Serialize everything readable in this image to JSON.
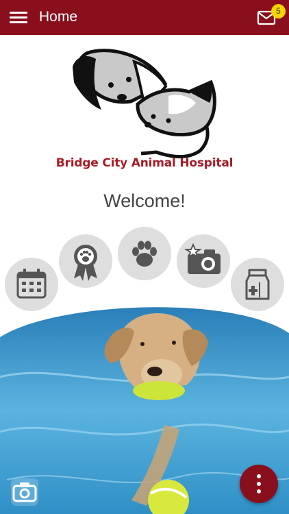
{
  "header": {
    "title": "Home",
    "menu_icon": "hamburger-menu-icon",
    "mail_icon": "mail-icon",
    "unread_count": "5"
  },
  "brand": {
    "name": "Bridge City Animal Hospital"
  },
  "main": {
    "welcome": "Welcome!"
  },
  "quick_actions": [
    {
      "icon": "calendar-icon"
    },
    {
      "icon": "award-ribbon-icon"
    },
    {
      "icon": "paw-icon"
    },
    {
      "icon": "camera-icon"
    },
    {
      "icon": "pet-food-bag-icon"
    }
  ],
  "footer": {
    "camera_icon": "camera-icon",
    "more_icon": "more-vertical-icon"
  },
  "colors": {
    "brand": "#8a0f1d",
    "badge": "#f5d500",
    "circle": "#dedede",
    "logo_text": "#a51d28"
  }
}
